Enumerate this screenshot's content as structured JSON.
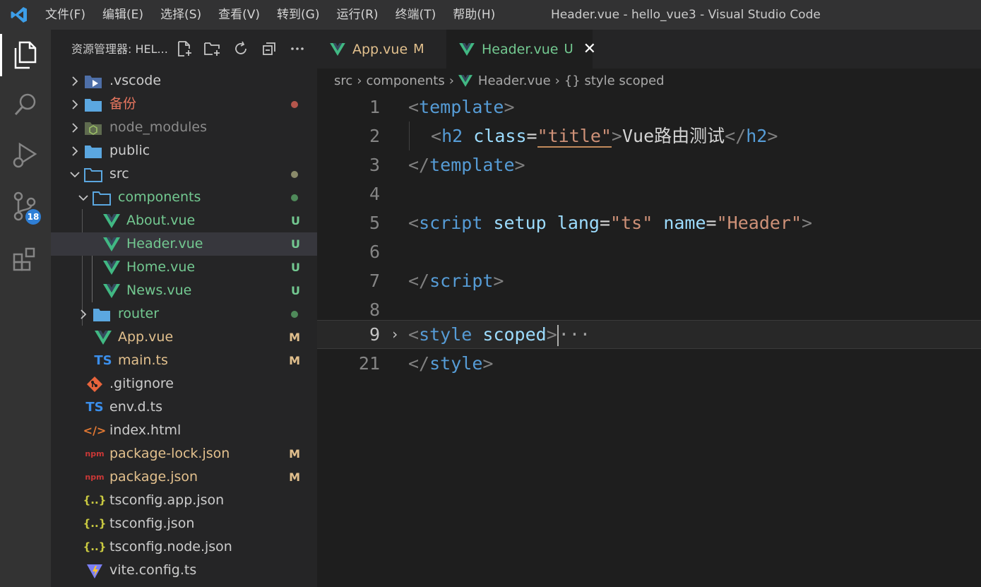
{
  "menu": [
    "文件(F)",
    "编辑(E)",
    "选择(S)",
    "查看(V)",
    "转到(G)",
    "运行(R)",
    "终端(T)",
    "帮助(H)"
  ],
  "window_title": "Header.vue - hello_vue3 - Visual Studio Code",
  "activity": {
    "scm_badge": "18"
  },
  "sidebar": {
    "title": "资源管理器: HEL...",
    "tree": [
      {
        "name": ".vscode",
        "status": ""
      },
      {
        "name": "备份",
        "status": ""
      },
      {
        "name": "node_modules",
        "status": ""
      },
      {
        "name": "public",
        "status": ""
      },
      {
        "name": "src",
        "status": ""
      },
      {
        "name": "components",
        "status": ""
      },
      {
        "name": "About.vue",
        "status": "U"
      },
      {
        "name": "Header.vue",
        "status": "U"
      },
      {
        "name": "Home.vue",
        "status": "U"
      },
      {
        "name": "News.vue",
        "status": "U"
      },
      {
        "name": "router",
        "status": ""
      },
      {
        "name": "App.vue",
        "status": "M"
      },
      {
        "name": "main.ts",
        "status": "M"
      },
      {
        "name": ".gitignore",
        "status": ""
      },
      {
        "name": "env.d.ts",
        "status": ""
      },
      {
        "name": "index.html",
        "status": ""
      },
      {
        "name": "package-lock.json",
        "status": "M"
      },
      {
        "name": "package.json",
        "status": "M"
      },
      {
        "name": "tsconfig.app.json",
        "status": ""
      },
      {
        "name": "tsconfig.json",
        "status": ""
      },
      {
        "name": "tsconfig.node.json",
        "status": ""
      },
      {
        "name": "vite.config.ts",
        "status": ""
      }
    ],
    "icon_labels": {
      "ts": "TS",
      "json": "{..}",
      "npm": "npm",
      "html": "</>"
    }
  },
  "tabs": [
    {
      "label": "App.vue",
      "status": "M"
    },
    {
      "label": "Header.vue",
      "status": "U"
    }
  ],
  "breadcrumb": [
    "src",
    "components",
    "Header.vue",
    "{} style scoped"
  ],
  "editor": {
    "line_numbers": [
      "1",
      "2",
      "3",
      "4",
      "5",
      "6",
      "7",
      "8",
      "9",
      "21"
    ],
    "tokens": {
      "lt": "<",
      "gt": ">",
      "lt_slash": "</",
      "template": "template",
      "h2": "h2",
      "class": "class",
      "eq": "=",
      "title": "\"title\"",
      "h2_text": "Vue路由测试",
      "script": "script",
      "setup": "setup",
      "lang": "lang",
      "ts": "\"ts\"",
      "name": "name",
      "header": "\"Header\"",
      "style": "style",
      "scoped": "scoped",
      "ellipsis": "···",
      "sp": " "
    }
  },
  "colors": {
    "accent": "#007acc",
    "untracked": "#73c991",
    "modified": "#e2c08d",
    "vue_green": "#41b883"
  }
}
